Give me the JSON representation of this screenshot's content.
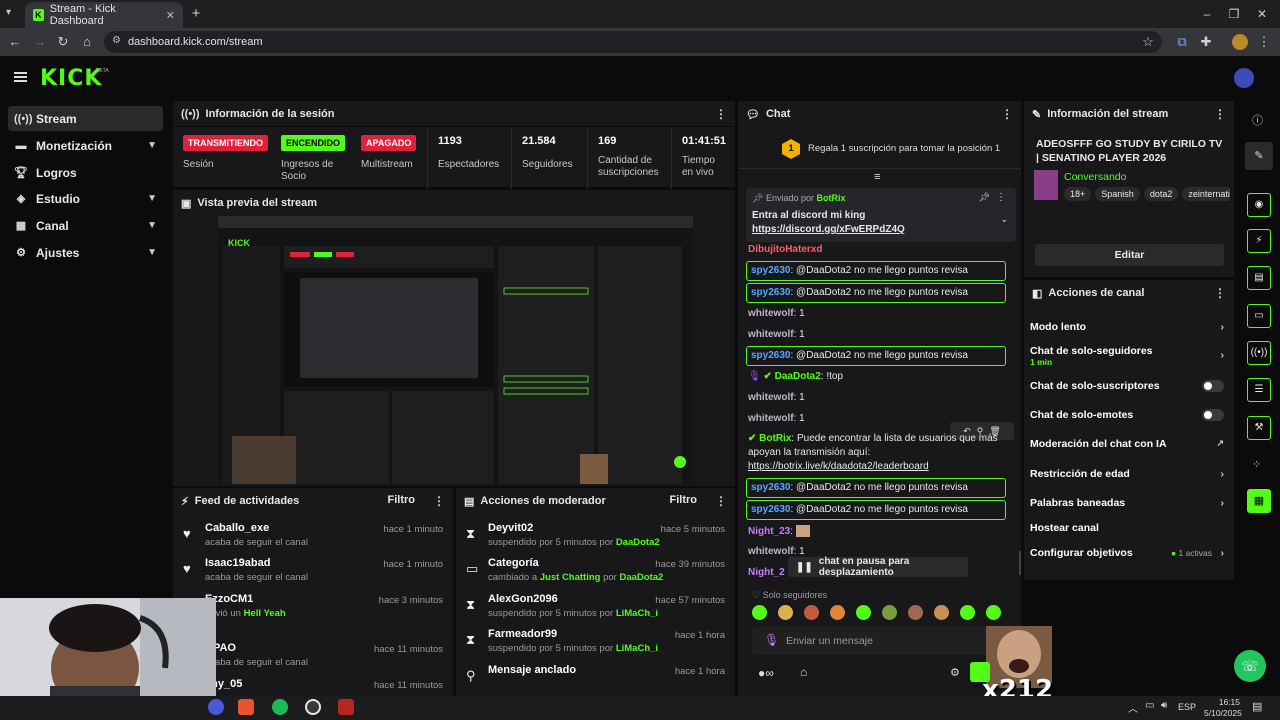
{
  "browser": {
    "tab_title": "Stream - Kick Dashboard",
    "url": "dashboard.kick.com/stream"
  },
  "header": {
    "logo": "KICK",
    "beta": "BETA"
  },
  "sidebar": {
    "items": [
      {
        "label": "Stream",
        "icon": "stream-icon"
      },
      {
        "label": "Monetización",
        "icon": "dollar-icon"
      },
      {
        "label": "Logros",
        "icon": "trophy-icon"
      },
      {
        "label": "Estudio",
        "icon": "layers-icon"
      },
      {
        "label": "Canal",
        "icon": "grid-icon"
      },
      {
        "label": "Ajustes",
        "icon": "gear-icon"
      }
    ]
  },
  "session": {
    "title": "Información de la sesión",
    "items": [
      {
        "badge": "TRANSMITIENDO",
        "label": "Sesión"
      },
      {
        "badge": "ENCENDIDO",
        "label": "Ingresos de Socio"
      },
      {
        "badge": "APAGADO",
        "label": "Multistream"
      }
    ],
    "stats": [
      {
        "value": "1193",
        "label": "Espectadores"
      },
      {
        "value": "21.584",
        "label": "Seguidores"
      },
      {
        "value": "169",
        "label": "Cantidad de suscripciones"
      },
      {
        "value": "01:41:51",
        "label": "Tiempo en vivo"
      }
    ]
  },
  "preview": {
    "title": "Vista previa del stream"
  },
  "activity": {
    "title": "Feed de actividades",
    "filter": "Filtro",
    "rows": [
      {
        "name": "Caballo_exe",
        "sub": "acaba de seguir el canal",
        "time": "hace 1 minuto"
      },
      {
        "name": "Isaac19abad",
        "sub": "acaba de seguir el canal",
        "time": "hace 1 minuto"
      },
      {
        "name": "EzzoCM1",
        "sub": "envió un",
        "sub_highlight": "Hell Yeah",
        "time": "hace 3 minutos"
      },
      {
        "name": "NPAO",
        "sub": "acaba de seguir el canal",
        "time": "hace 11 minutos"
      },
      {
        "name": "chy_05",
        "sub": "",
        "time": "hace 11 minutos"
      }
    ]
  },
  "moderator": {
    "title": "Acciones de moderador",
    "filter": "Filtro",
    "rows": [
      {
        "name": "Deyvit02",
        "sub": "suspendido por 5 minutos por",
        "by": "DaaDota2",
        "time": "hace 5 minutos"
      },
      {
        "name": "Categoría",
        "sub": "cambiado a",
        "cat": "Just Chatting",
        "sub2": "por",
        "by": "DaaDota2",
        "time": "hace 39 minutos"
      },
      {
        "name": "AlexGon2096",
        "sub": "suspendido por 5 minutos por",
        "by": "LiMaCh_i",
        "time": "hace 57 minutos"
      },
      {
        "name": "Farmeador99",
        "sub": "suspendido por 5 minutos por",
        "by": "LiMaCh_i",
        "time": "hace 1 hora"
      },
      {
        "name": "Mensaje anclado",
        "sub": "",
        "time": "hace 1 hora"
      }
    ]
  },
  "chat": {
    "title": "Chat",
    "sub_banner": "Regala 1 suscripción para tomar la posición 1",
    "pinned_label": "Enviado por",
    "pinned_user": "BotRix",
    "pinned_text": "Entra al discord mi king",
    "pinned_link": "https://discord.gg/xFwERPdZ4Q",
    "messages": [
      {
        "user": "DibujitoHaterxd",
        "text": ""
      },
      {
        "user": "spy2630",
        "text": "@DaaDota2 no me llego puntos revisa"
      },
      {
        "user": "spy2630",
        "text": "@DaaDota2 no me llego puntos revisa"
      },
      {
        "user": "whitewolf",
        "text": "1"
      },
      {
        "user": "whitewolf",
        "text": "1"
      },
      {
        "user": "spy2630",
        "text": "@DaaDota2 no me llego puntos revisa"
      },
      {
        "user": "DaaDota2",
        "text": "!top"
      },
      {
        "user": "whitewolf",
        "text": "1"
      },
      {
        "user": "whitewolf",
        "text": "1"
      },
      {
        "user": "BotRix",
        "text": "Puede encontrar la lista de usuarios que más apoyan la transmisión aquí:",
        "link": "https://botrix.live/k/daadota2/leaderboard"
      },
      {
        "user": "spy2630",
        "text": "@DaaDota2 no me llego puntos revisa"
      },
      {
        "user": "spy2630",
        "text": "@DaaDota2 no me llego puntos revisa"
      },
      {
        "user": "Night_23",
        "text": ""
      },
      {
        "user": "whitewolf",
        "text": "1"
      },
      {
        "user": "Night_2",
        "text": ""
      }
    ],
    "paused": "chat en pausa para desplazamiento",
    "followers_only": "Solo seguidores",
    "input_placeholder": "Enviar un mensaje",
    "combo": "x212"
  },
  "stream_info": {
    "title": "Información del stream",
    "stream_title": "ADEOSFFF GO STUDY BY CIRILO TV | SENATINO PLAYER 2026",
    "category": "Conversando",
    "tags": [
      "18+",
      "Spanish",
      "dota2",
      "zeinternati"
    ],
    "edit": "Editar"
  },
  "channel_actions": {
    "title": "Acciones de canal",
    "items": [
      {
        "label": "Modo lento",
        "type": "arrow"
      },
      {
        "label": "Chat de solo-seguidores",
        "sub": "1 min",
        "type": "arrow"
      },
      {
        "label": "Chat de solo-suscriptores",
        "type": "toggle"
      },
      {
        "label": "Chat de solo-emotes",
        "type": "toggle"
      },
      {
        "label": "Moderación del chat con IA",
        "type": "external"
      },
      {
        "label": "Restricción de edad",
        "type": "arrow"
      },
      {
        "label": "Palabras baneadas",
        "type": "arrow"
      },
      {
        "label": "Hostear canal",
        "type": "none"
      },
      {
        "label": "Configurar objetivos",
        "sub": "1 activas",
        "type": "arrow"
      }
    ]
  },
  "taskbar": {
    "lang": "ESP",
    "time": "16:15",
    "date": "5/10/2025"
  },
  "colors": {
    "accent": "#53fc18",
    "live": "#e0213b",
    "panel": "#18181b",
    "bg": "#0b0b0c"
  }
}
